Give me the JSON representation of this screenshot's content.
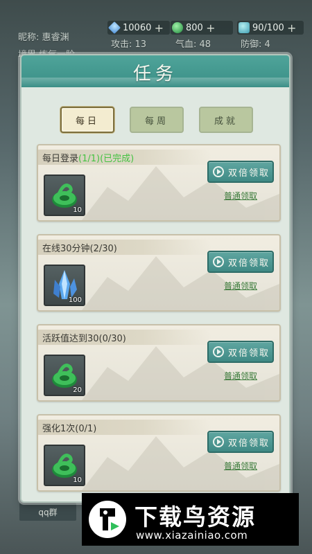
{
  "hud": {
    "resources": [
      {
        "icon": "crystal-icon",
        "value": "10060"
      },
      {
        "icon": "jade-icon",
        "value": "800"
      },
      {
        "icon": "energy-icon",
        "value": "90/100"
      }
    ],
    "nickname": "昵称: 惠睿渊",
    "attack": "攻击: 13",
    "qi_blood": "气血: 48",
    "defense": "防御: 4",
    "realm": "境界  炼气一阶"
  },
  "dialog": {
    "title": "任务",
    "tabs": [
      {
        "label": "每日",
        "active": true
      },
      {
        "label": "每周",
        "active": false
      },
      {
        "label": "成就",
        "active": false
      }
    ],
    "tasks": [
      {
        "name": "每日登录",
        "progress": "(1/1)(已完成)",
        "reward_icon": "jade-icon",
        "reward_amount": "10",
        "double_label": "双倍领取",
        "normal_label": "普通领取"
      },
      {
        "name": "在线30分钟",
        "progress": "(2/30)",
        "reward_icon": "crystal-icon",
        "reward_amount": "100",
        "double_label": "双倍领取",
        "normal_label": "普通领取"
      },
      {
        "name": "活跃值达到30",
        "progress": "(0/30)",
        "reward_icon": "jade-icon",
        "reward_amount": "20",
        "double_label": "双倍领取",
        "normal_label": "普通领取"
      },
      {
        "name": "强化1次",
        "progress": "(0/1)",
        "reward_icon": "jade-icon",
        "reward_amount": "10",
        "double_label": "双倍领取",
        "normal_label": "普通领取"
      }
    ]
  },
  "footer": {
    "qq_group": "qq群"
  },
  "watermark": {
    "brand": "下载鸟资源",
    "url": "www.xiazainiao.com"
  }
}
